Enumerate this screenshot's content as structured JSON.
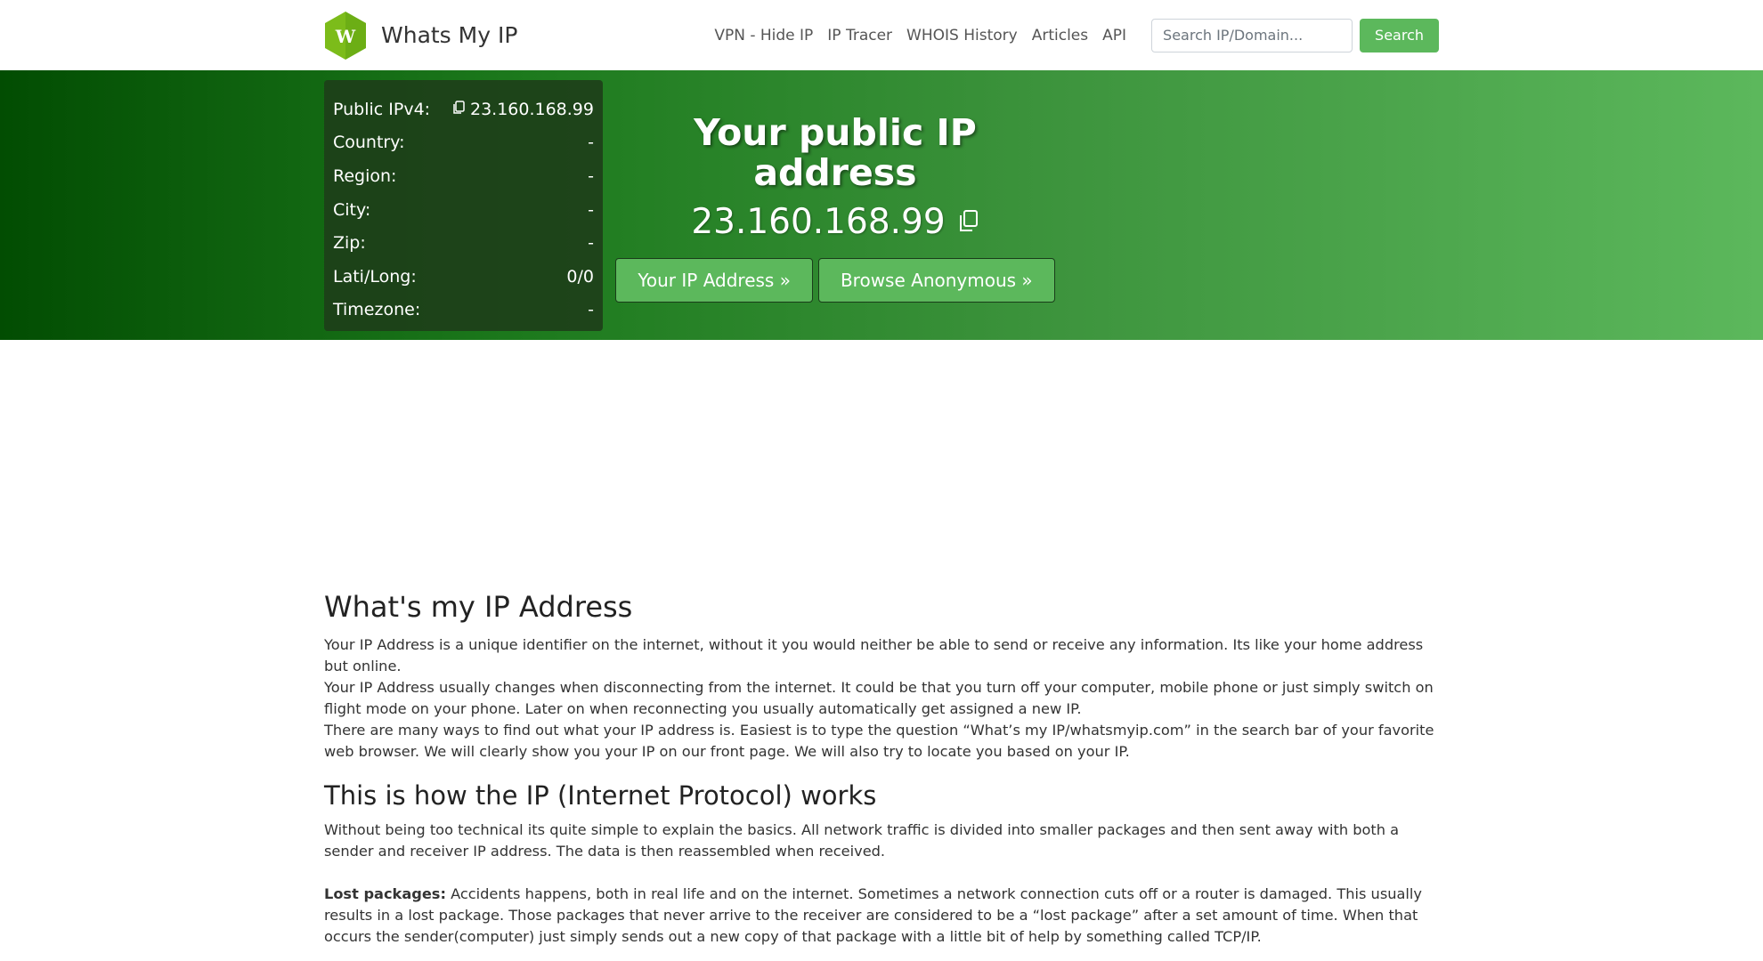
{
  "brand": {
    "logo_letter": "W",
    "name": "Whats My IP",
    "color": "#7cbc1a"
  },
  "nav": {
    "links": [
      "VPN - Hide IP",
      "IP Tracer",
      "WHOIS History",
      "Articles",
      "API"
    ],
    "search_placeholder": "Search IP/Domain...",
    "search_button": "Search"
  },
  "info_box": {
    "rows": [
      {
        "label": "Public IPv4:",
        "value": "23.160.168.99"
      },
      {
        "label": "Country:",
        "value": "-"
      },
      {
        "label": "Region:",
        "value": "-"
      },
      {
        "label": "City:",
        "value": "-"
      },
      {
        "label": "Zip:",
        "value": "-"
      },
      {
        "label": "Lati/Long:",
        "value": "0/0"
      },
      {
        "label": "Timezone:",
        "value": "-"
      }
    ]
  },
  "hero": {
    "title": "Your public IP address",
    "ip": "23.160.168.99",
    "buttons": [
      "Your IP Address »",
      "Browse Anonymous »"
    ]
  },
  "content": {
    "h1": "What's my IP Address",
    "p1": "Your IP Address is a unique identifier on the internet, without it you would neither be able to send or receive any information. Its like your home address but online.",
    "p2": "Your IP Address usually changes when disconnecting from the internet. It could be that you turn off your computer, mobile phone or just simply switch on flight mode on your phone. Later on when reconnecting you usually automatically get assigned a new IP.",
    "p3": "There are many ways to find out what your IP address is. Easiest is to type the question “What’s my IP/whatsmyip.com” in the search bar of your favorite web browser. We will clearly show you your IP on our front page. We will also try to locate you based on your IP.",
    "h2": "This is how the IP (Internet Protocol) works",
    "p4": "Without being too technical its quite simple to explain the basics. All network traffic is divided into smaller packages and then sent away with both a sender and receiver IP address. The data is then reassembled when received.",
    "p5_bold": "Lost packages:",
    "p5": " Accidents happens, both in real life and on the internet. Sometimes a network connection cuts off or a router is damaged. This usually results in a lost package. Those packages that never arrive to the receiver are considered to be a “lost package” after a set amount of time. When that occurs the sender(computer) just simply sends out a new copy of that package with a little bit of help by something called TCP/IP."
  }
}
